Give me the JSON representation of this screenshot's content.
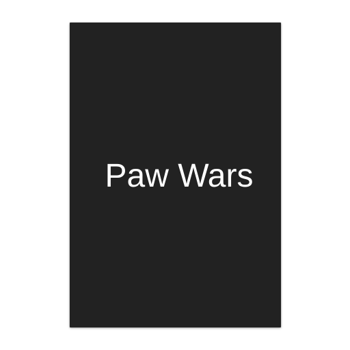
{
  "cover": {
    "title": "Paw Wars",
    "background_color": "#222222",
    "text_color": "#ffffff"
  }
}
